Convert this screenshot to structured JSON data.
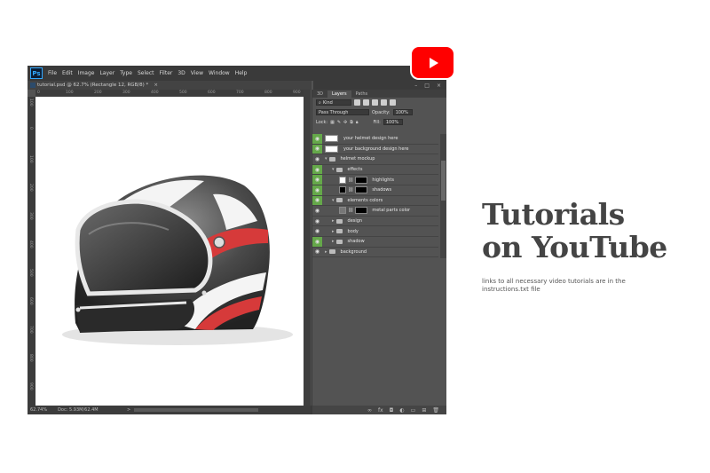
{
  "menubar": {
    "logo": "Ps",
    "items": [
      "File",
      "Edit",
      "Image",
      "Layer",
      "Type",
      "Select",
      "Filter",
      "3D",
      "View",
      "Window",
      "Help"
    ]
  },
  "document": {
    "tab_title": "tutorial.psd @ 62.7% (Rectangle 12, RGB/8) *",
    "close_glyph": "×"
  },
  "window_controls": [
    "–",
    "□",
    "×"
  ],
  "rulers": {
    "h_labels": [
      "0",
      "100",
      "200",
      "300",
      "400",
      "500",
      "600",
      "700",
      "800",
      "900"
    ],
    "v_labels": [
      "100",
      "0",
      "100",
      "200",
      "300",
      "400",
      "500",
      "600",
      "700",
      "800",
      "900"
    ]
  },
  "status": {
    "zoom": "62.74%",
    "doc": "Doc: 5.93M/62.4M",
    "arrow": ">"
  },
  "panel": {
    "tabs": [
      "3D",
      "Layers",
      "Paths"
    ],
    "active_tab": "Layers",
    "kind_label": "Kind",
    "blend_mode": "Pass Through",
    "opacity_label": "Opacity:",
    "opacity_value": "100%",
    "lock_label": "Lock:",
    "fill_label": "Fill:",
    "fill_value": "100%",
    "layers": [
      {
        "name": "your helmet design here",
        "type": "smart",
        "eye_green": true,
        "indent": 0
      },
      {
        "name": "your background design here",
        "type": "smart",
        "eye_green": true,
        "indent": 0
      },
      {
        "name": "helmet mockup",
        "type": "group",
        "eye_green": false,
        "indent": 0,
        "expanded": true
      },
      {
        "name": "effects",
        "type": "group",
        "eye_green": true,
        "indent": 1,
        "expanded": true
      },
      {
        "name": "highlights",
        "type": "masked",
        "eye_green": true,
        "indent": 2,
        "fill": "#ffffff"
      },
      {
        "name": "shadows",
        "type": "masked",
        "eye_green": true,
        "indent": 2,
        "fill": "#000000"
      },
      {
        "name": "elements colors",
        "type": "group",
        "eye_green": true,
        "indent": 1,
        "expanded": true
      },
      {
        "name": "metal parts color",
        "type": "masked",
        "eye_green": false,
        "indent": 2,
        "fill": "#777777"
      },
      {
        "name": "design",
        "type": "group",
        "eye_green": false,
        "indent": 1,
        "expanded": false
      },
      {
        "name": "body",
        "type": "group",
        "eye_green": false,
        "indent": 1,
        "expanded": false
      },
      {
        "name": "shadow",
        "type": "group",
        "eye_green": true,
        "indent": 1,
        "expanded": false
      },
      {
        "name": "background",
        "type": "group",
        "eye_green": false,
        "indent": 0,
        "expanded": false
      }
    ]
  },
  "headline": {
    "line1": "Tutorials",
    "line2": "on YouTube"
  },
  "subtitle": "links to all necessary video tutorials are in the instructions.txt file",
  "colors": {
    "accent_green": "#65a84a",
    "youtube_red": "#ff0000",
    "ps_blue": "#31a8ff"
  }
}
